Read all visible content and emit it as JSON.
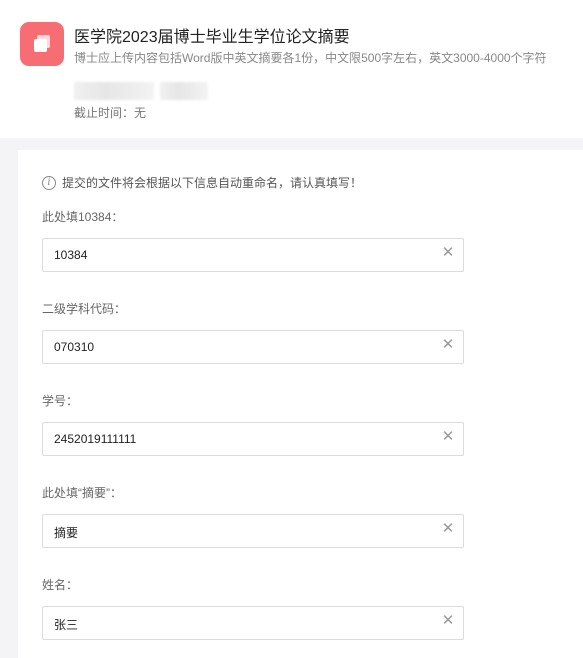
{
  "header": {
    "title": "医学院2023届博士毕业生学位论文摘要",
    "subtitle": "博士应上传内容包括Word版中英文摘要各1份，中文限500字左右，英文3000-4000个字符",
    "deadline": "截止时间：无",
    "icon": "folder-icon",
    "accent_color": "#f76d74"
  },
  "form": {
    "notice": "提交的文件将会根据以下信息自动重命名，请认真填写！",
    "fields": [
      {
        "label": "此处填10384：",
        "value": "10384"
      },
      {
        "label": "二级学科代码：",
        "value": "070310"
      },
      {
        "label": "学号：",
        "value": "2452019111111"
      },
      {
        "label": "此处填“摘要”：",
        "value": "摘要"
      },
      {
        "label": "姓名：",
        "value": "张三"
      }
    ]
  }
}
